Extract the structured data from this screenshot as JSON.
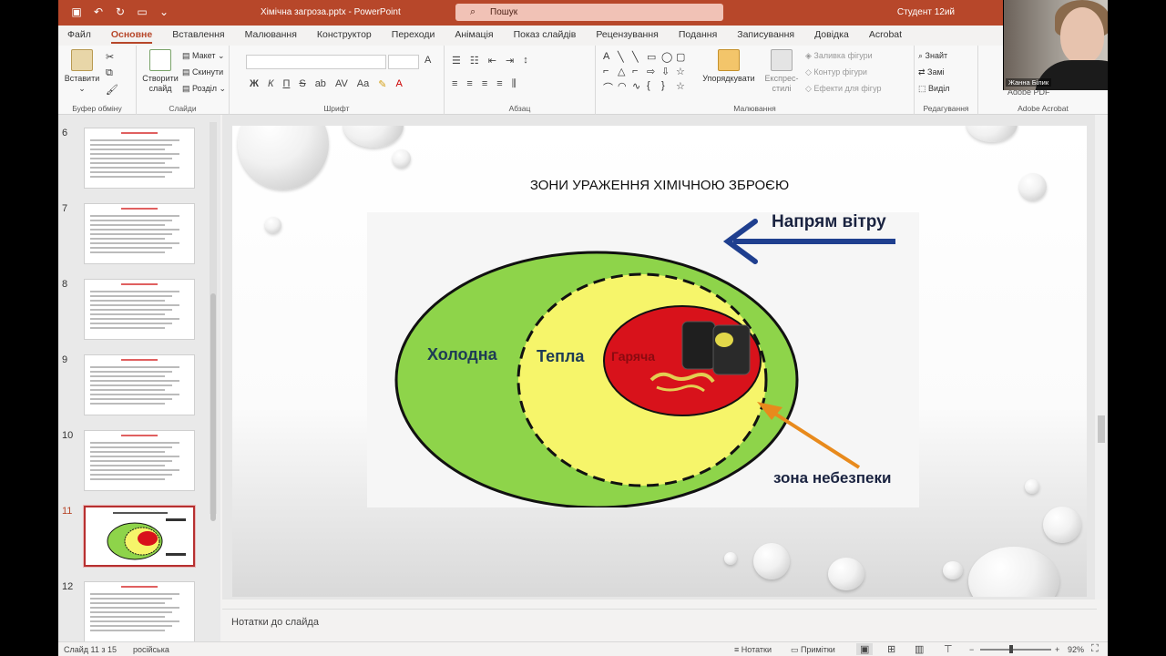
{
  "window": {
    "title": "Хімічна загроза.pptx - PowerPoint",
    "search_placeholder": "Пошук",
    "user": "Студент 12ий"
  },
  "tabs": [
    "Файл",
    "Основне",
    "Вставлення",
    "Малювання",
    "Конструктор",
    "Переходи",
    "Анімація",
    "Показ слайдів",
    "Рецензування",
    "Подання",
    "Записування",
    "Довідка",
    "Acrobat"
  ],
  "active_tab": "Основне",
  "ribbon": {
    "clipboard": {
      "paste": "Вставити",
      "label": "Буфер обміну"
    },
    "slides": {
      "new_slide_1": "Створити",
      "new_slide_2": "слайд",
      "layout": "Макет",
      "reset": "Скинути",
      "section": "Розділ",
      "label": "Слайди"
    },
    "font": {
      "label": "Шрифт",
      "bold": "Ж",
      "italic": "К",
      "underline": "П",
      "strike": "S"
    },
    "paragraph": {
      "label": "Абзац"
    },
    "drawing": {
      "arrange": "Упорядкувати",
      "quick_styles_1": "Експрес-",
      "quick_styles_2": "стилі",
      "fill": "Заливка фігури",
      "outline": "Контур фігури",
      "effects": "Ефекти для фігур",
      "label": "Малювання"
    },
    "editing": {
      "find": "Знайт",
      "replace": "Замі",
      "select": "Виділ",
      "label": "Редагування"
    },
    "acrobat": {
      "title": "Adobe PDF",
      "label": "Adobe Acrobat"
    }
  },
  "thumbnails": [
    {
      "num": "6"
    },
    {
      "num": "7"
    },
    {
      "num": "8"
    },
    {
      "num": "9"
    },
    {
      "num": "10"
    },
    {
      "num": "11",
      "selected": true
    },
    {
      "num": "12"
    }
  ],
  "slide": {
    "title": "ЗОНИ УРАЖЕННЯ ХІМІЧНОЮ ЗБРОЄЮ",
    "labels": {
      "cold": "Холодна",
      "warm": "Тепла",
      "hot": "Гаряча",
      "wind": "Напрям вітру",
      "danger": "зона небезпеки"
    }
  },
  "notes_placeholder": "Нотатки до слайда",
  "status": {
    "slide": "Слайд 11 з 15",
    "language": "російська",
    "notes": "Нотатки",
    "comments": "Примітки",
    "zoom": "92%"
  },
  "webcam": {
    "name": "Жанна Білик"
  },
  "colors": {
    "accent": "#b7472a",
    "cold_zone": "#8ed44a",
    "warm_zone": "#f6f56a",
    "hot_zone": "#d8121b",
    "wind_arrow": "#1f3f8f",
    "danger_arrow": "#e88a1c"
  }
}
